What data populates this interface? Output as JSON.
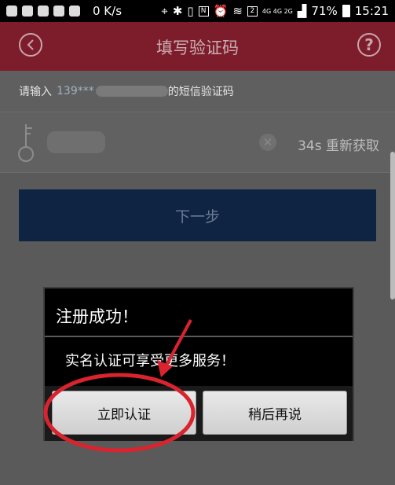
{
  "status_bar": {
    "network_speed": "0 K/s",
    "network_types": "4G 4G 2G",
    "battery": "71%",
    "time": "15:21"
  },
  "header": {
    "title": "填写验证码",
    "help_symbol": "?"
  },
  "prompt": {
    "prefix": "请输入",
    "phone": "139***",
    "suffix": "的短信验证码"
  },
  "code_field": {
    "resend_label": "34s 重新获取"
  },
  "next_button": {
    "label": "下一步"
  },
  "dialog": {
    "title": "注册成功！",
    "message": "实名认证可享受更多服务！",
    "confirm_label": "立即认证",
    "later_label": "稍后再说"
  },
  "colors": {
    "header_bg": "#7d1d2b",
    "primary_button": "#0e2442",
    "annotation": "#d9232f"
  }
}
